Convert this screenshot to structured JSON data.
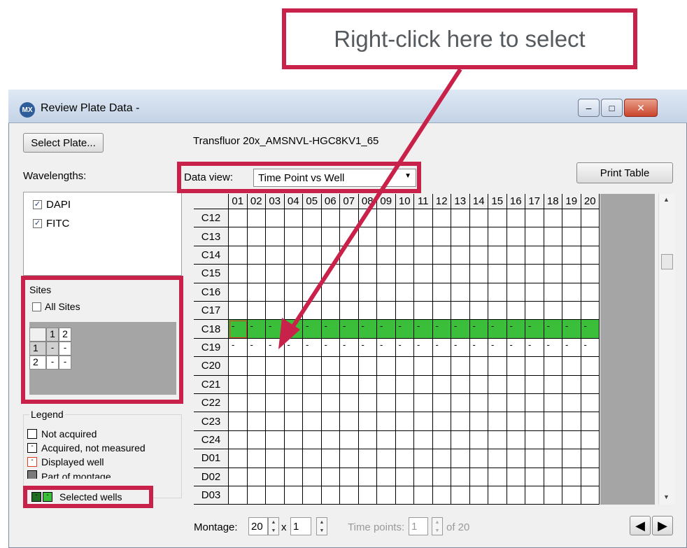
{
  "callout": {
    "text": "Right-click here to select"
  },
  "window": {
    "title": "Review Plate Data -",
    "app_icon_text": "MX",
    "controls": {
      "minimize": "–",
      "maximize": "□",
      "close": "✕"
    }
  },
  "left": {
    "select_plate_label": "Select Plate...",
    "wavelengths_label": "Wavelengths:",
    "wavelengths": [
      {
        "label": "DAPI",
        "checked": true
      },
      {
        "label": "FITC",
        "checked": true
      }
    ],
    "sites": {
      "title": "Sites",
      "all_sites_label": "All Sites",
      "all_sites_checked": false,
      "col_headers": [
        "1",
        "2"
      ],
      "rows": [
        {
          "label": "1",
          "cells": [
            "-",
            "-"
          ]
        },
        {
          "label": "2",
          "cells": [
            "-",
            "-"
          ]
        }
      ]
    },
    "legend": {
      "title": "Legend",
      "items": [
        {
          "label": "Not acquired",
          "swatch": "empty"
        },
        {
          "label": "Acquired, not measured",
          "swatch": "dash"
        },
        {
          "label": "Displayed well",
          "swatch": "red"
        },
        {
          "label": "Part of montage",
          "swatch": "gray"
        }
      ],
      "selected_label": "Selected wells"
    }
  },
  "main": {
    "plate_name": "Transfluor 20x_AMSNVL-HGC8KV1_65",
    "data_view_label": "Data view:",
    "data_view_value": "Time Point vs Well",
    "print_table_label": "Print Table",
    "columns": [
      "01",
      "02",
      "03",
      "04",
      "05",
      "06",
      "07",
      "08",
      "09",
      "10",
      "11",
      "12",
      "13",
      "14",
      "15",
      "16",
      "17",
      "18",
      "19",
      "20"
    ],
    "rows": [
      {
        "label": "C12",
        "state": "empty"
      },
      {
        "label": "C13",
        "state": "empty"
      },
      {
        "label": "C14",
        "state": "empty"
      },
      {
        "label": "C15",
        "state": "empty"
      },
      {
        "label": "C16",
        "state": "empty"
      },
      {
        "label": "C17",
        "state": "empty"
      },
      {
        "label": "C18",
        "state": "selected"
      },
      {
        "label": "C19",
        "state": "acquired"
      },
      {
        "label": "C20",
        "state": "empty"
      },
      {
        "label": "C21",
        "state": "empty"
      },
      {
        "label": "C22",
        "state": "empty"
      },
      {
        "label": "C23",
        "state": "empty"
      },
      {
        "label": "C24",
        "state": "empty"
      },
      {
        "label": "D01",
        "state": "empty"
      },
      {
        "label": "D02",
        "state": "empty"
      },
      {
        "label": "D03",
        "state": "empty"
      }
    ],
    "cell_mark": "-",
    "montage_label": "Montage:",
    "montage_x": "20",
    "montage_x_sep": "x",
    "montage_y": "1",
    "time_points_label": "Time points:",
    "time_points_value": "1",
    "time_points_of": "of 20"
  },
  "colors": {
    "accent": "#c8224a",
    "selected_green": "#3bbf3b",
    "displayed_red": "#e04020",
    "montage_gray": "#a5a5a5"
  }
}
